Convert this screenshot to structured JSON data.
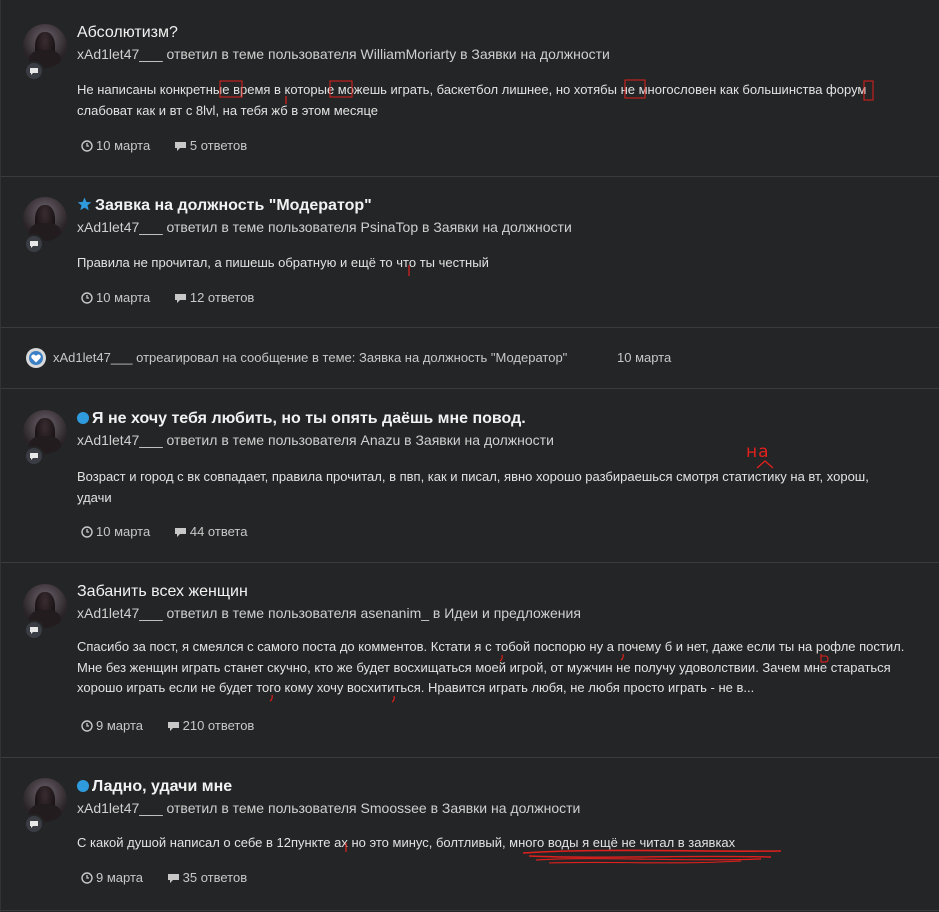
{
  "activity": [
    {
      "title": "Абсолютизм?",
      "author": "xAd1let47___",
      "action": "ответил в теме пользователя",
      "topic_author": "WilliamMoriarty",
      "in_word": "в",
      "forum": "Заявки на должности",
      "excerpt": "Не написаны конкретные время в которые можешь играть, баскетбол лишнее, но хотябы не многословен как большинства форум слабоват как и вт с 8lvl, на тебя жб в этом месяце",
      "date": "10 марта",
      "replies": "5 ответов"
    },
    {
      "title": "Заявка на должность \"Модератор\"",
      "author": "xAd1let47___",
      "action": "ответил в теме пользователя",
      "topic_author": "PsinaTop",
      "in_word": "в",
      "forum": "Заявки на должности",
      "excerpt": "Правила не прочитал, а пишешь обратную и ещё то что ты честный",
      "date": "10 марта",
      "replies": "12 ответов"
    },
    {
      "title": "Я не хочу тебя любить, но ты опять даёшь мне повод.",
      "author": "xAd1let47___",
      "action": "ответил в теме пользователя",
      "topic_author": "Anazu",
      "in_word": "в",
      "forum": "Заявки на должности",
      "excerpt": "Возраст и город с вк совпадает, правила прочитал, в пвп, как и писал, явно хорошо разбираешься смотря статистику на вт, хорош, удачи",
      "date": "10 марта",
      "replies": "44 ответа"
    },
    {
      "title": "Забанить всех женщин",
      "author": "xAd1let47___",
      "action": "ответил в теме пользователя",
      "topic_author": "asenanim_",
      "in_word": "в",
      "forum": "Идеи и предложения",
      "excerpt": "Спасибо за пост, я смеялся с самого поста до комментов. Кстати я с тобой поспорю ну а почему б и нет, даже если ты на рофле постил. Мне без женщин играть станет скучно, кто же будет восхищаться моей игрой, от мужчин не получу удоволствии. Зачем мне стараться хорошо играть если не будет того кому хочу восхититься. Нравится играть любя, не любя просто играть - не в...",
      "date": "9 марта",
      "replies": "210 ответов"
    },
    {
      "title": "Ладно, удачи мне",
      "author": "xAd1let47___",
      "action": "ответил в теме пользователя",
      "topic_author": "Smoossee",
      "in_word": "в",
      "forum": "Заявки на должности",
      "excerpt": "С какой душой написал о себе в 12пункте ах но это минус, болтливый, много воды я ещё не читал в заявках",
      "date": "9 марта",
      "replies": "35 ответов"
    }
  ],
  "reaction": {
    "author": "xAd1let47___",
    "text": "отреагировал на сообщение в теме: Заявка на должность \"Модератор\"",
    "date": "10 марта"
  },
  "annotation": {
    "handwritten": "на"
  },
  "colors": {
    "background": "#242526",
    "unread_dot": "#2f9bde",
    "featured_star": "#2f9bde",
    "annotation": "#e0201c",
    "reaction_icon": "#3b7fc4"
  }
}
